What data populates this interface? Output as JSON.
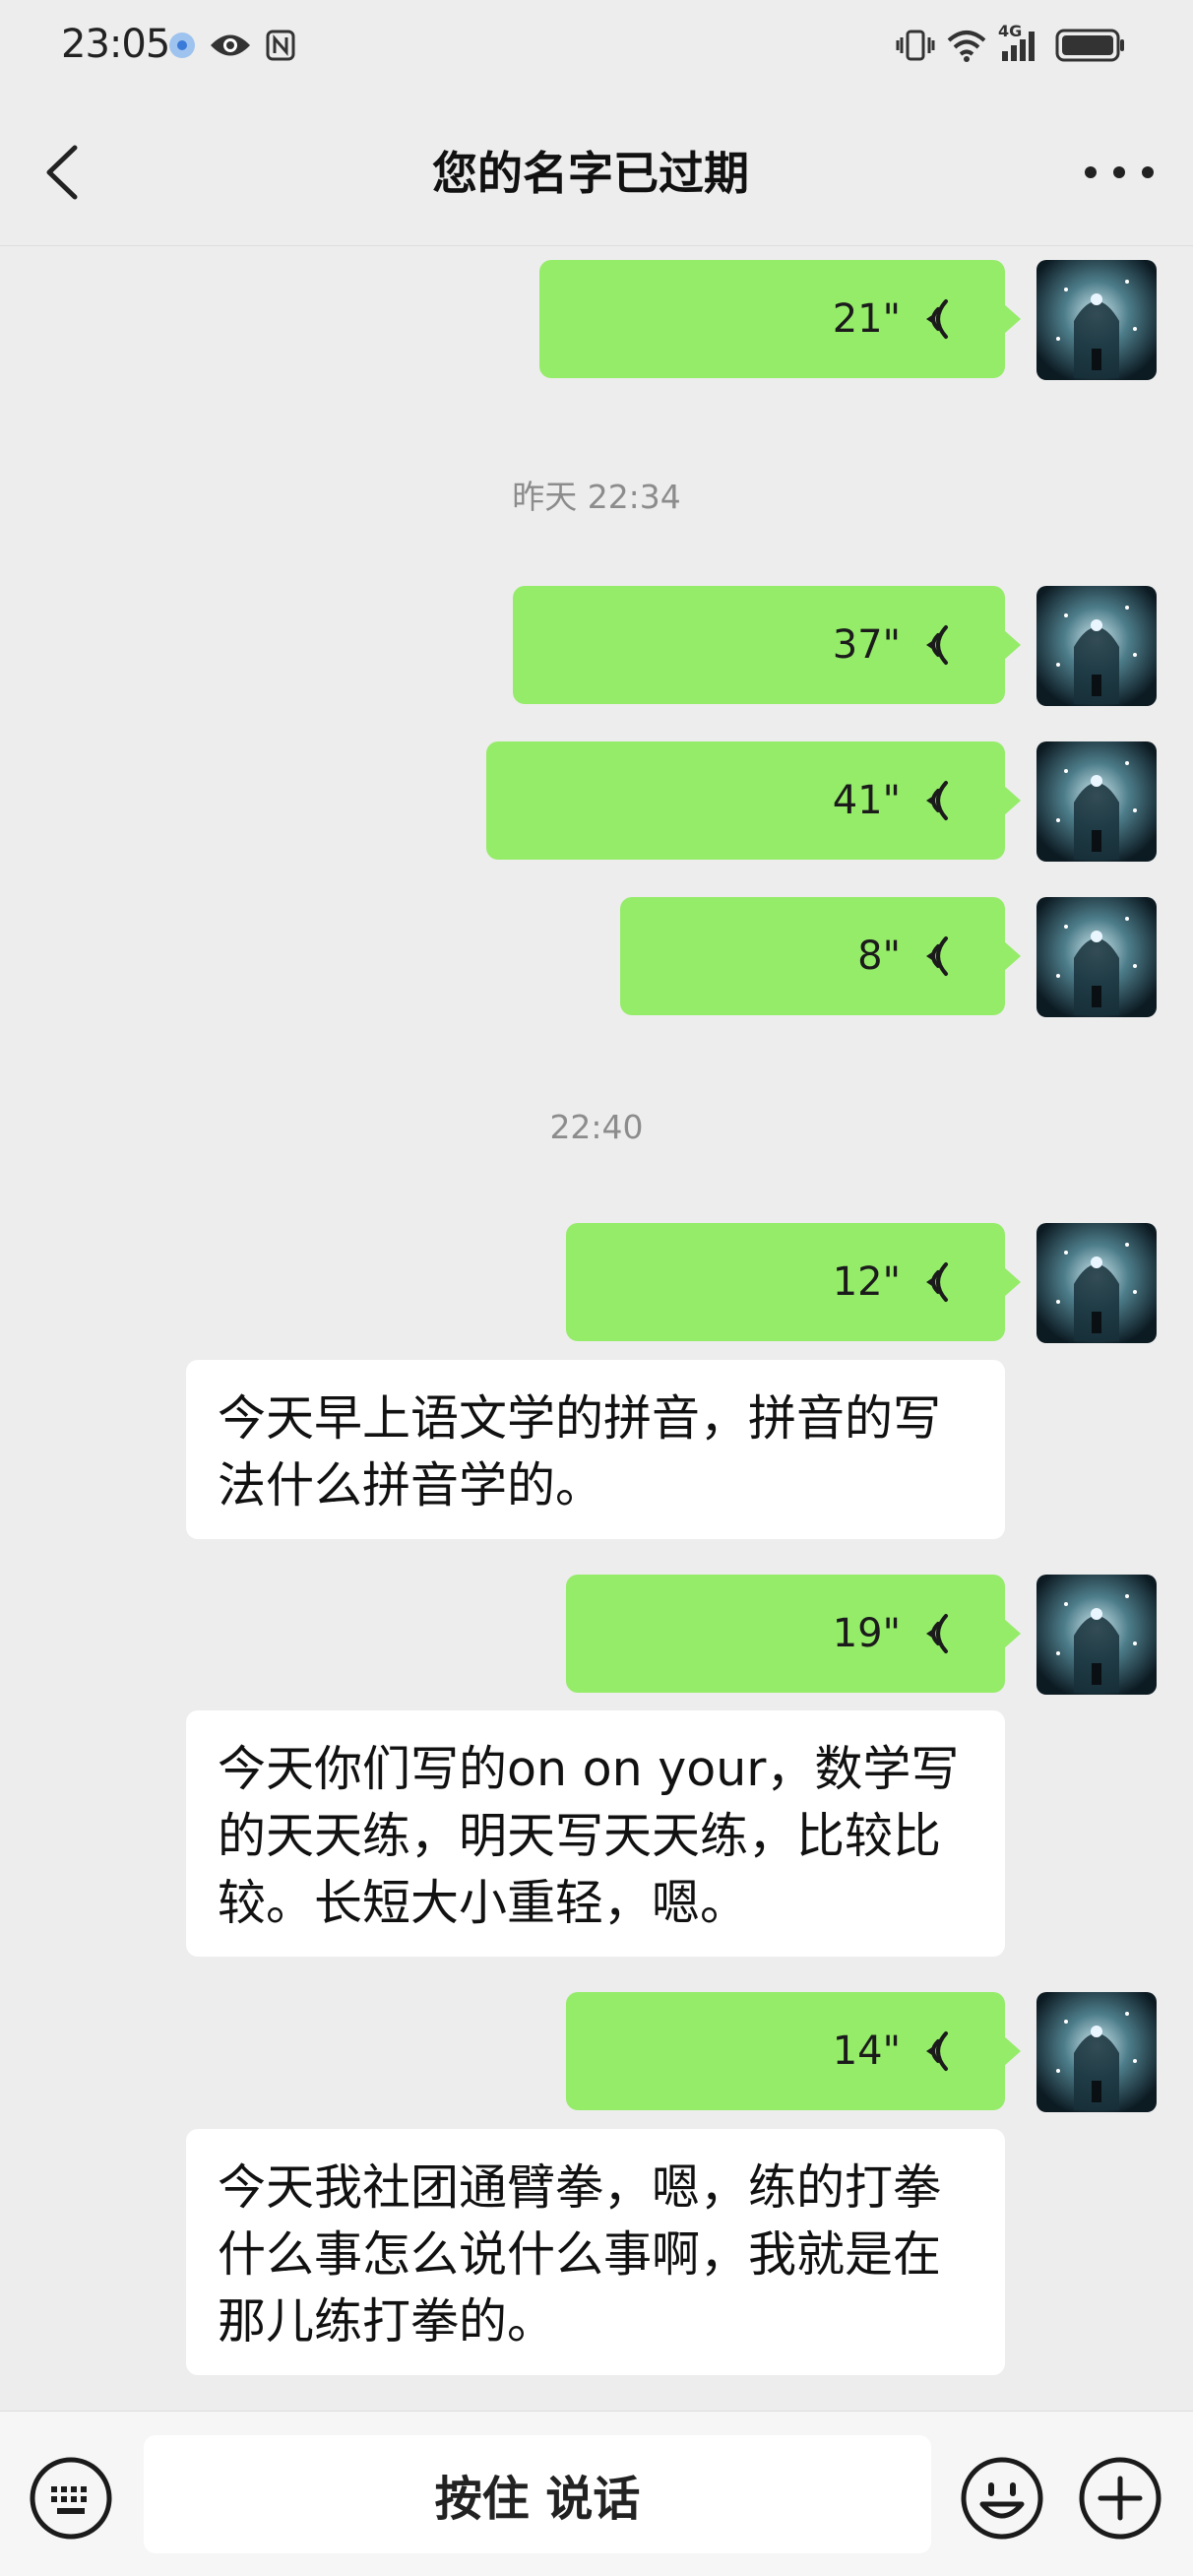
{
  "status_bar": {
    "time": "23:05",
    "left_icons": [
      "location-dot-icon",
      "eye-icon",
      "nfc-icon"
    ],
    "right_icons": [
      "vibrate-icon",
      "wifi-icon",
      "signal-4g-icon",
      "battery-icon"
    ],
    "network_label": "4G"
  },
  "header": {
    "title": "您的名字已过期",
    "back_icon": "chevron-left-icon",
    "more_icon": "more-dots-icon"
  },
  "timestamps": {
    "t1": "昨天 22:34",
    "t2": "22:40"
  },
  "messages": {
    "v1": {
      "duration": "21\""
    },
    "v2": {
      "duration": "37\""
    },
    "v3": {
      "duration": "41\""
    },
    "v4": {
      "duration": "8\""
    },
    "v5": {
      "duration": "12\"",
      "transcript_lines": [
        "今天早上语文学的拼音，拼音的写",
        "法什么拼音学的。"
      ]
    },
    "v6": {
      "duration": "19\"",
      "transcript_lines": [
        "今天你们写的on on your，数学写",
        "的天天练，明天写天天练，比较比",
        "较。长短大小重轻，嗯。"
      ]
    },
    "v7": {
      "duration": "14\"",
      "transcript_lines": [
        "今天我社团通臂拳，嗯，练的打拳",
        "什么事怎么说什么事啊，我就是在",
        "那儿练打拳的。"
      ]
    }
  },
  "input_bar": {
    "hold_to_talk_label": "按住 说话",
    "keyboard_icon": "keyboard-icon",
    "emoji_icon": "emoji-icon",
    "plus_icon": "plus-icon"
  },
  "colors": {
    "background": "#ededed",
    "voice_bubble": "#95ec69",
    "transcript_bubble": "#ffffff",
    "timestamp_text": "#8c8c8c"
  }
}
